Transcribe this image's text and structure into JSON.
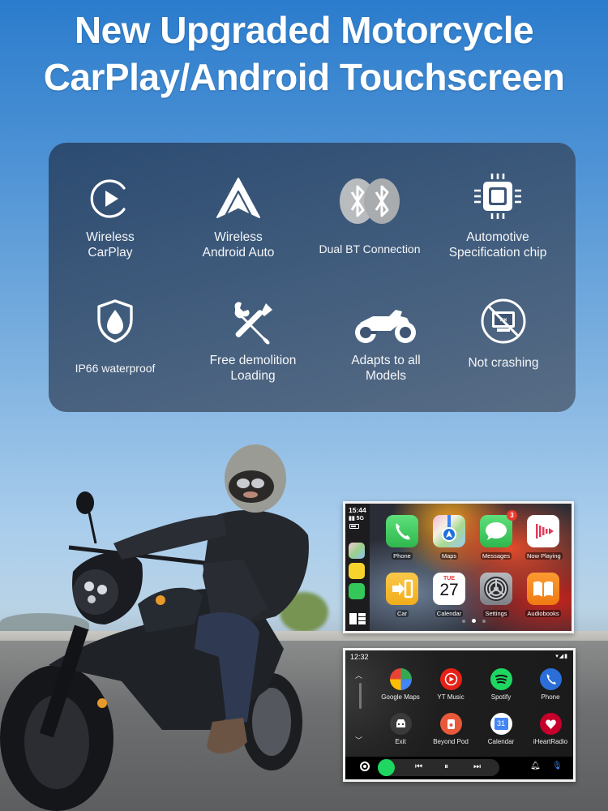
{
  "headline": {
    "line1": "New Upgraded Motorcycle",
    "line2": "CarPlay/Android Touchscreen"
  },
  "features": [
    {
      "icon": "carplay-icon",
      "line1": "Wireless",
      "line2": "CarPlay"
    },
    {
      "icon": "android-auto-icon",
      "line1": "Wireless",
      "line2": "Android Auto"
    },
    {
      "icon": "dual-bluetooth-icon",
      "line1": "Dual BT Connection",
      "line2": ""
    },
    {
      "icon": "chip-icon",
      "line1": "Automotive",
      "line2": "Specification chip"
    },
    {
      "icon": "waterproof-shield-icon",
      "line1": "IP66 waterproof",
      "line2": ""
    },
    {
      "icon": "tools-icon",
      "line1": "Free demolition",
      "line2": "Loading"
    },
    {
      "icon": "motorcycle-icon",
      "line1": "Adapts to all",
      "line2": "Models"
    },
    {
      "icon": "no-crash-icon",
      "line1": "Not crashing",
      "line2": ""
    }
  ],
  "carplay": {
    "time": "15:44",
    "signal": "5G",
    "apps": [
      {
        "name": "Phone",
        "color": "#34c759"
      },
      {
        "name": "Maps",
        "color": "#e9eef2"
      },
      {
        "name": "Messages",
        "color": "#34c759",
        "badge": "3"
      },
      {
        "name": "Now Playing",
        "color": "#ffffff"
      },
      {
        "name": "Car",
        "color": "#f5b829"
      },
      {
        "name": "Calendar",
        "color": "#ffffff",
        "day": "TUE",
        "date": "27"
      },
      {
        "name": "Settings",
        "color": "#8e8e93"
      },
      {
        "name": "Audiobooks",
        "color": "#f7871d"
      }
    ],
    "page_count": 3,
    "active_page": 2
  },
  "android_auto": {
    "time": "12:32",
    "status_icons": "▾◢▮",
    "apps": [
      {
        "name": "Google Maps",
        "color": "#ffffff"
      },
      {
        "name": "YT Music",
        "color": "#e62117"
      },
      {
        "name": "Spotify",
        "color": "#1ed760"
      },
      {
        "name": "Phone",
        "color": "#2c6ed8"
      },
      {
        "name": "Exit",
        "color": "#3a3a3a"
      },
      {
        "name": "Beyond Pod",
        "color": "#e8583a"
      },
      {
        "name": "Calendar",
        "color": "#ffffff",
        "date": "31"
      },
      {
        "name": "iHeartRadio",
        "color": "#c6002b"
      }
    ],
    "media_controls": {
      "prev": "⏮",
      "pause": "⏸",
      "next": "⏭"
    }
  }
}
